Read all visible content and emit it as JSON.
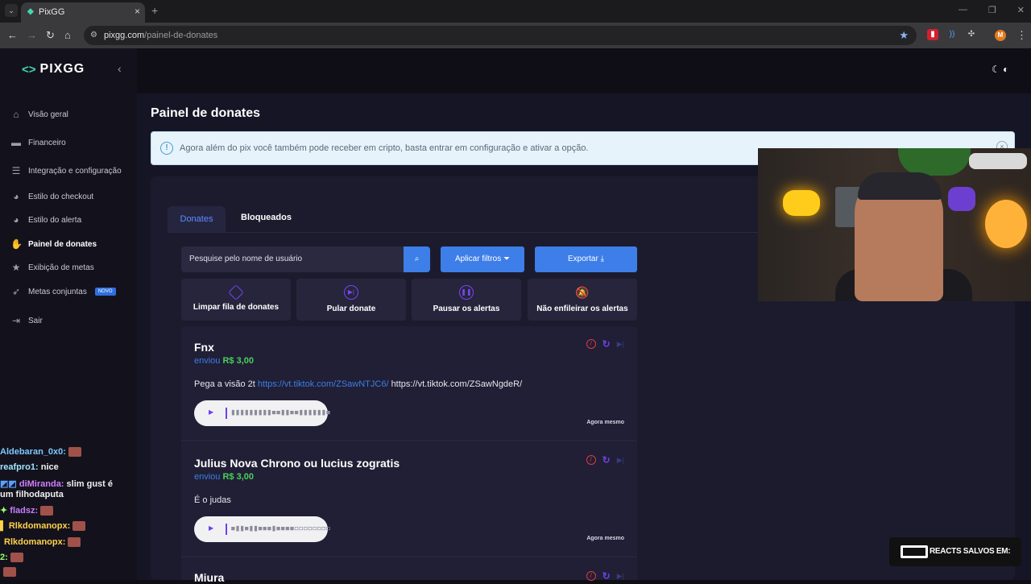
{
  "browser": {
    "tab_title": "PixGG",
    "url_domain": "pixgg.com",
    "url_path": "/painel-de-donates",
    "profile_initial": "M"
  },
  "sidebar": {
    "logo": "PIXGG",
    "items": [
      {
        "label": "Visão geral",
        "icon": "home-icon"
      },
      {
        "label": "Financeiro",
        "icon": "wallet-icon"
      },
      {
        "label": "Integração e configuração",
        "icon": "settings-icon"
      },
      {
        "label": "Estilo do checkout",
        "icon": "palette-icon"
      },
      {
        "label": "Estilo do alerta",
        "icon": "palette-icon"
      },
      {
        "label": "Painel de donates",
        "icon": "donate-hand-icon"
      },
      {
        "label": "Exibição de metas",
        "icon": "star-icon"
      },
      {
        "label": "Metas conjuntas",
        "icon": "rocket-icon",
        "badge": "NOVO"
      },
      {
        "label": "Sair",
        "icon": "logout-icon"
      }
    ],
    "active_index": 5
  },
  "chat": [
    {
      "user": "Aldebaran_0x0:",
      "text": "",
      "color": "#7ec8ff"
    },
    {
      "user": "reafpro1:",
      "text": "nice",
      "color": "#9fe6ff"
    },
    {
      "user": "diMiranda:",
      "text": "slim gust é",
      "color": "#d27dff"
    },
    {
      "user": "",
      "text": "um filhodaputa",
      "color": "#ffffff"
    },
    {
      "user": "fladsz:",
      "text": "",
      "color": "#c87dff"
    },
    {
      "user": "Rlkdomanopx:",
      "text": "",
      "color": "#ffd24a"
    },
    {
      "user": "Rlkdomanopx:",
      "text": "",
      "color": "#ffd24a"
    },
    {
      "user": "2:",
      "text": "",
      "color": "#9cff6a"
    }
  ],
  "page": {
    "title": "Painel de donates",
    "alert": "Agora além do pix você também pode receber em cripto, basta entrar em configuração e ativar a opção.",
    "tabs": [
      "Donates",
      "Bloqueados"
    ],
    "search_placeholder": "Pesquise pelo nome de usuário",
    "filter_button": "Aplicar filtros",
    "export_button": "Exportar",
    "actions": [
      {
        "label": "Limpar fila de donates",
        "icon": "eraser-icon"
      },
      {
        "label": "Pular donate",
        "icon": "skip-icon"
      },
      {
        "label": "Pausar os alertas",
        "icon": "pause-icon"
      },
      {
        "label": "Não enfileirar os alertas",
        "icon": "bell-off-icon"
      }
    ]
  },
  "donates": [
    {
      "name": "Fnx",
      "sent_label": "enviou",
      "amount": "R$ 3,00",
      "message_prefix": "Pega a visão 2t",
      "message_link": "https://vt.tiktok.com/ZSawNTJC6/",
      "message_suffix": "https://vt.tiktok.com/ZSawNgdeR/",
      "time": "Agora mesmo"
    },
    {
      "name": "Julius Nova Chrono ou lucius zogratis",
      "sent_label": "enviou",
      "amount": "R$ 3,00",
      "message_prefix": "É o judas",
      "message_link": "",
      "message_suffix": "",
      "time": "Agora mesmo"
    },
    {
      "name": "Miura",
      "sent_label": "",
      "amount": "",
      "message_prefix": "",
      "message_link": "",
      "message_suffix": "",
      "time": ""
    }
  ],
  "overlay": {
    "reacts_text": "REACTS SALVOS EM:"
  },
  "colors": {
    "accent": "#3d7ee8",
    "brand": "#45d6b0",
    "purple": "#6e40e8",
    "money": "#49d15a",
    "danger": "#e03a44"
  }
}
